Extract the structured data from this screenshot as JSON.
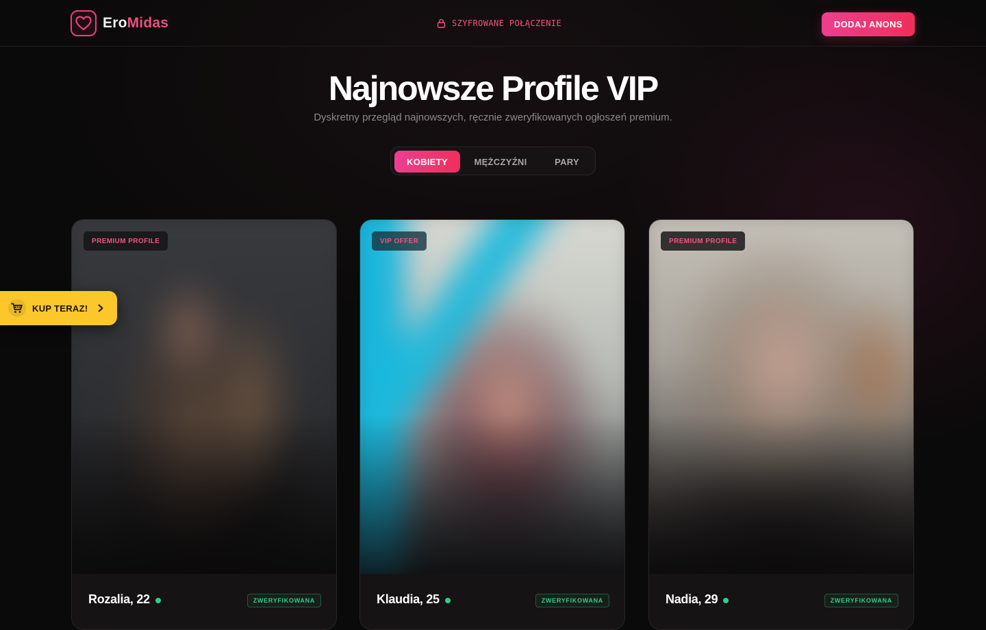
{
  "header": {
    "logo_part1": "Ero",
    "logo_part2": "Midas",
    "secure_label": "SZYFROWANE POŁĄCZENIE",
    "add_button": "DODAJ ANONS"
  },
  "hero": {
    "title": "Najnowsze Profile VIP",
    "subtitle": "Dyskretny przegląd najnowszych, ręcznie zweryfikowanych ogłoszeń premium."
  },
  "tabs": [
    {
      "label": "KOBIETY",
      "active": true
    },
    {
      "label": "MĘŻCZYŹNI",
      "active": false
    },
    {
      "label": "PARY",
      "active": false
    }
  ],
  "profiles": [
    {
      "badge": "PREMIUM PROFILE",
      "name": "Rozalia, 22",
      "status": "ZWERYFIKOWANA",
      "online": true
    },
    {
      "badge": "VIP OFFER",
      "name": "Klaudia, 25",
      "status": "ZWERYFIKOWANA",
      "online": true
    },
    {
      "badge": "PREMIUM PROFILE",
      "name": "Nadia, 29",
      "status": "ZWERYFIKOWANA",
      "online": true
    }
  ],
  "buy_button": {
    "label": "KUP TERAZ!"
  },
  "colors": {
    "accent": "#ef2f5b",
    "accent_pink": "#ec3f8f",
    "verified": "#34c98a",
    "buy": "#fbc72b",
    "background": "#0b0a0a"
  },
  "icons": {
    "logo": "heart-icon",
    "secure": "lock-icon",
    "buy": "cart-icon",
    "buy_arrow": "chevron-right-icon"
  }
}
